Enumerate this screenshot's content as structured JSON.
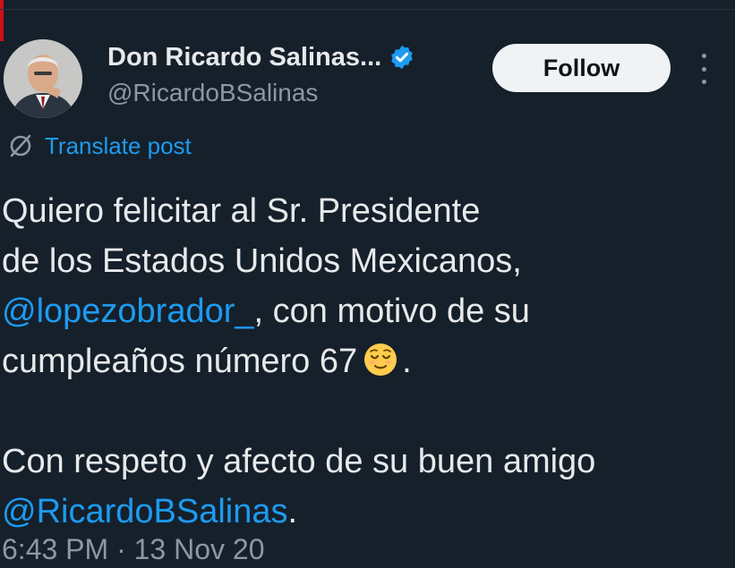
{
  "author": {
    "display_name": "Don Ricardo Salinas...",
    "handle": "@RicardoBSalinas",
    "verified": true
  },
  "actions": {
    "follow_label": "Follow",
    "more_icon": "more-vertical-icon"
  },
  "translate": {
    "label": "Translate post",
    "icon": "translate-globe-icon"
  },
  "post": {
    "line1": "Quiero felicitar al Sr. Presidente",
    "line2": "de los Estados Unidos Mexicanos,",
    "line3_mention": "@lopezobrador_",
    "line3_rest": ", con motivo de su",
    "line4": "cumpleaños número 67",
    "line4_end": ".",
    "line5": "Con respeto y afecto de su buen amigo",
    "line6_mention": "@RicardoBSalinas",
    "line6_end": "."
  },
  "meta": {
    "timestamp": "6:43 PM · 13 Nov 20"
  },
  "colors": {
    "background": "#15202b",
    "accent": "#1d9bf0",
    "text": "#e7e9ea",
    "muted": "#8b98a5"
  }
}
